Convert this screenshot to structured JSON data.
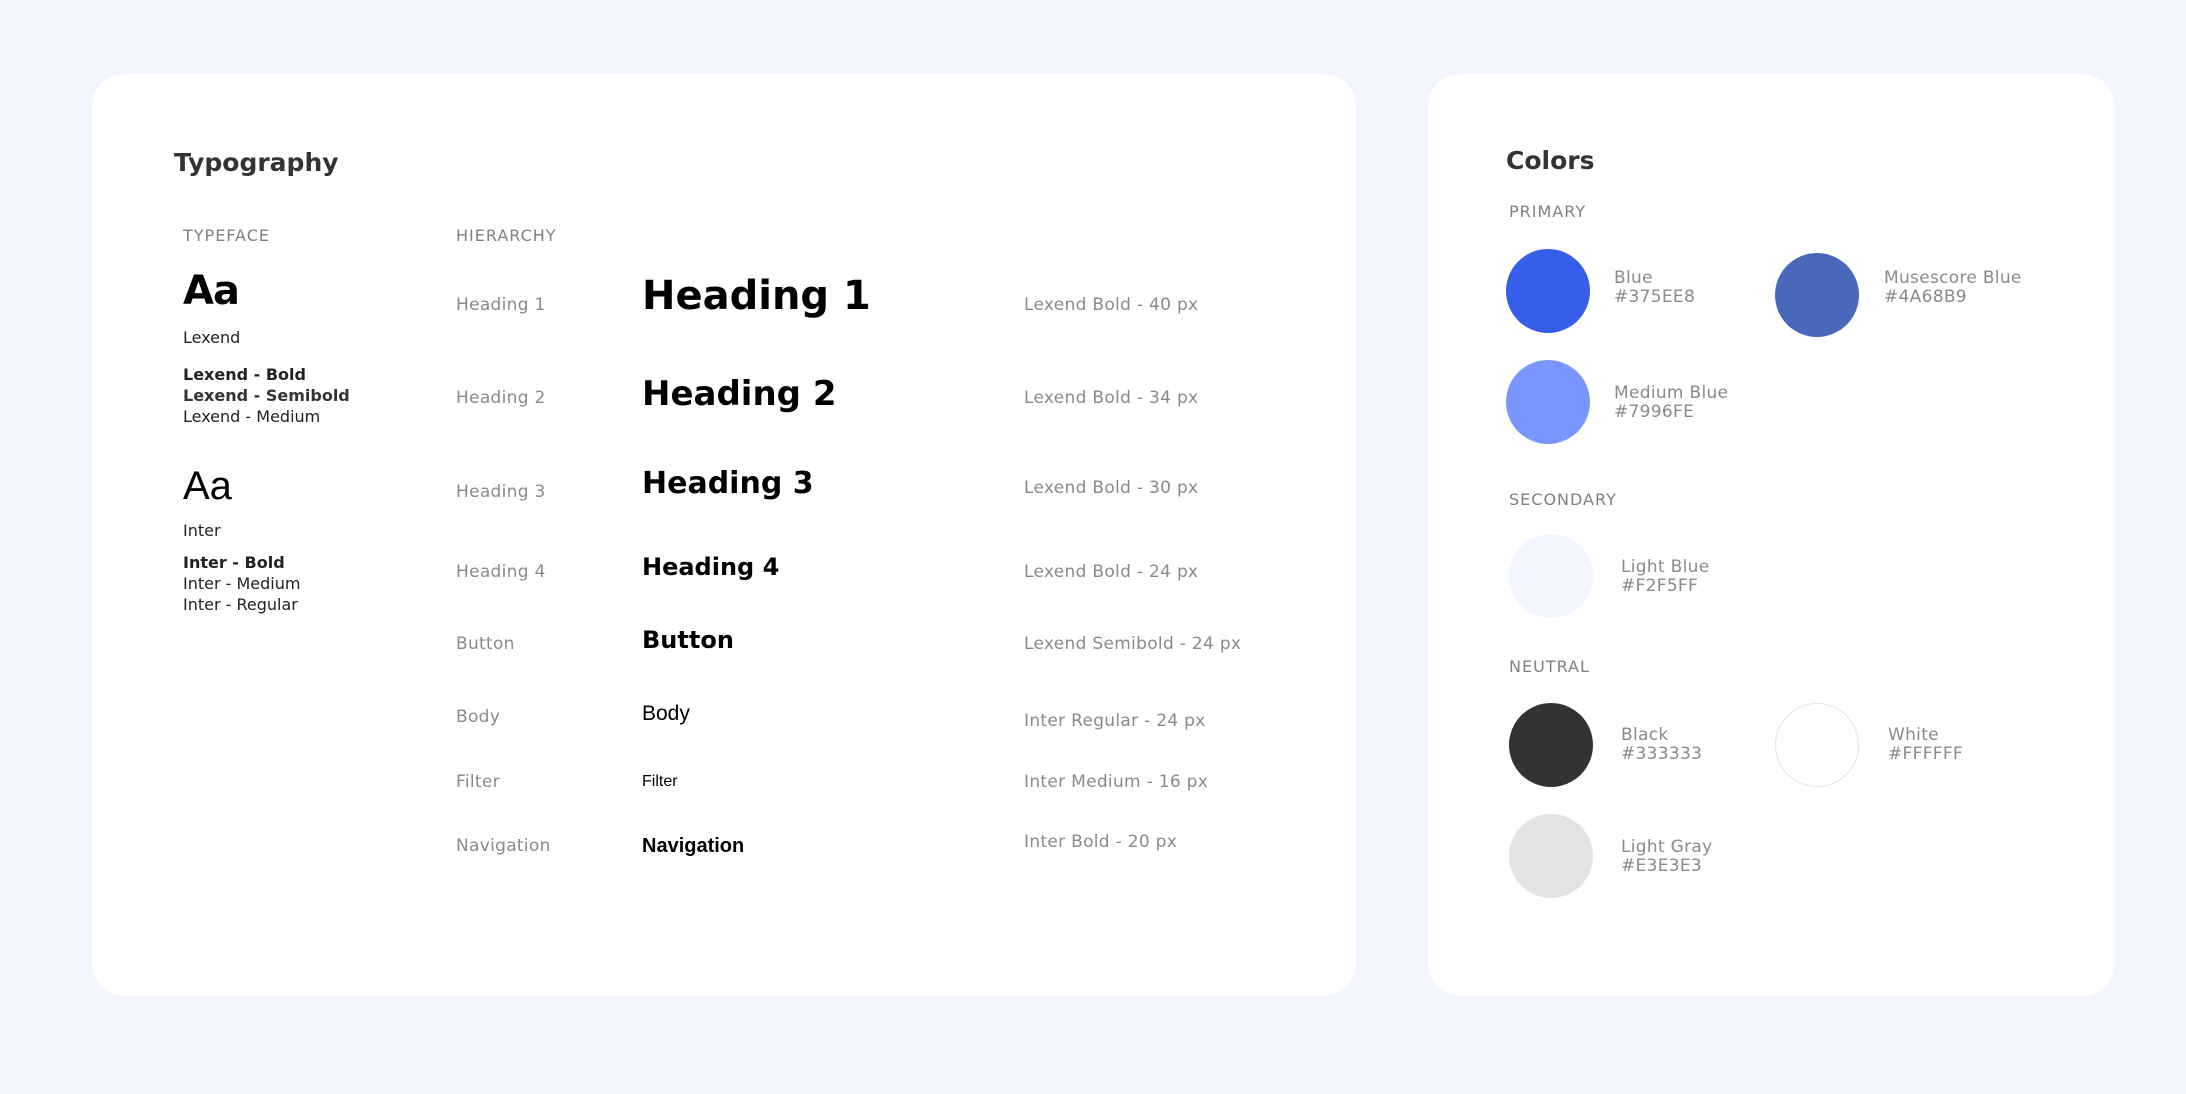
{
  "typography": {
    "title": "Typography",
    "typeface_label": "TYPEFACE",
    "hierarchy_label": "HIERARCHY",
    "lexend": {
      "sample": "Aa",
      "name": "Lexend",
      "weights": [
        "Lexend - Bold",
        "Lexend - Semibold",
        "Lexend - Medium"
      ]
    },
    "inter": {
      "sample": "Aa",
      "name": "Inter",
      "weights": [
        "Inter - Bold",
        "Inter - Medium",
        "Inter - Regular"
      ]
    },
    "rows": [
      {
        "label": "Heading 1",
        "sample": "Heading 1",
        "spec": "Lexend Bold - 40 px"
      },
      {
        "label": "Heading 2",
        "sample": "Heading 2",
        "spec": "Lexend Bold - 34 px"
      },
      {
        "label": "Heading 3",
        "sample": "Heading 3",
        "spec": "Lexend Bold - 30 px"
      },
      {
        "label": "Heading 4",
        "sample": "Heading 4",
        "spec": "Lexend Bold - 24 px"
      },
      {
        "label": "Button",
        "sample": "Button",
        "spec": "Lexend Semibold - 24 px"
      },
      {
        "label": "Body",
        "sample": "Body",
        "spec": "Inter Regular - 24 px"
      },
      {
        "label": "Filter",
        "sample": "Filter",
        "spec": "Inter Medium - 16 px"
      },
      {
        "label": "Navigation",
        "sample": "Navigation",
        "spec": "Inter Bold - 20 px"
      }
    ]
  },
  "colors": {
    "title": "Colors",
    "primary_label": "PRIMARY",
    "secondary_label": "SECONDARY",
    "neutral_label": "NEUTRAL",
    "primary": [
      {
        "name": "Blue",
        "hex": "#375EE8"
      },
      {
        "name": "Musescore Blue",
        "hex": "#4A68B9"
      },
      {
        "name": "Medium Blue",
        "hex": "#7996FE"
      }
    ],
    "secondary": [
      {
        "name": "Light Blue",
        "hex": "#F2F5FF"
      }
    ],
    "neutral": [
      {
        "name": "Black",
        "hex": "#333333"
      },
      {
        "name": "White",
        "hex": "#FFFFFF"
      },
      {
        "name": "Light Gray",
        "hex": "#E3E3E3"
      }
    ]
  }
}
